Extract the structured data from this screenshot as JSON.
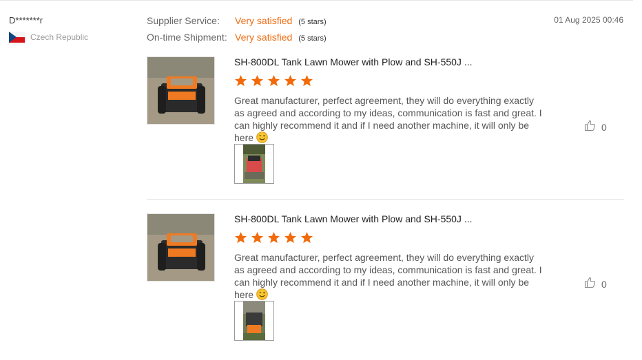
{
  "buyer": {
    "name": "D*******r",
    "country": "Czech Republic",
    "flag_icon": "czech-flag-icon"
  },
  "ratings": [
    {
      "label": "Supplier Service:",
      "value": "Very satisfied",
      "stars_text": "(5 stars)"
    },
    {
      "label": "On-time Shipment:",
      "value": "Very satisfied",
      "stars_text": "(5 stars)"
    }
  ],
  "date": "01 Aug 2025 00:46",
  "colors": {
    "accent": "#ef6c12",
    "star": "#f26a0a"
  },
  "reviews": [
    {
      "product_title": "SH-800DL Tank Lawn Mower with Plow and SH-550J ...",
      "rating": 5,
      "text": "Great manufacturer, perfect agreement, they will do everything exactly as agreed and according to my ideas, communication is fast and great. I can highly recommend it and if I need another machine, it will only be here",
      "emoji_icon": "wink-emoji-icon",
      "like_icon": "thumbs-up-icon",
      "likes": "0"
    },
    {
      "product_title": "SH-800DL Tank Lawn Mower with Plow and SH-550J ...",
      "rating": 5,
      "text": "Great manufacturer, perfect agreement, they will do everything exactly as agreed and according to my ideas, communication is fast and great. I can highly recommend it and if I need another machine, it will only be here",
      "emoji_icon": "wink-emoji-icon",
      "like_icon": "thumbs-up-icon",
      "likes": "0"
    }
  ]
}
